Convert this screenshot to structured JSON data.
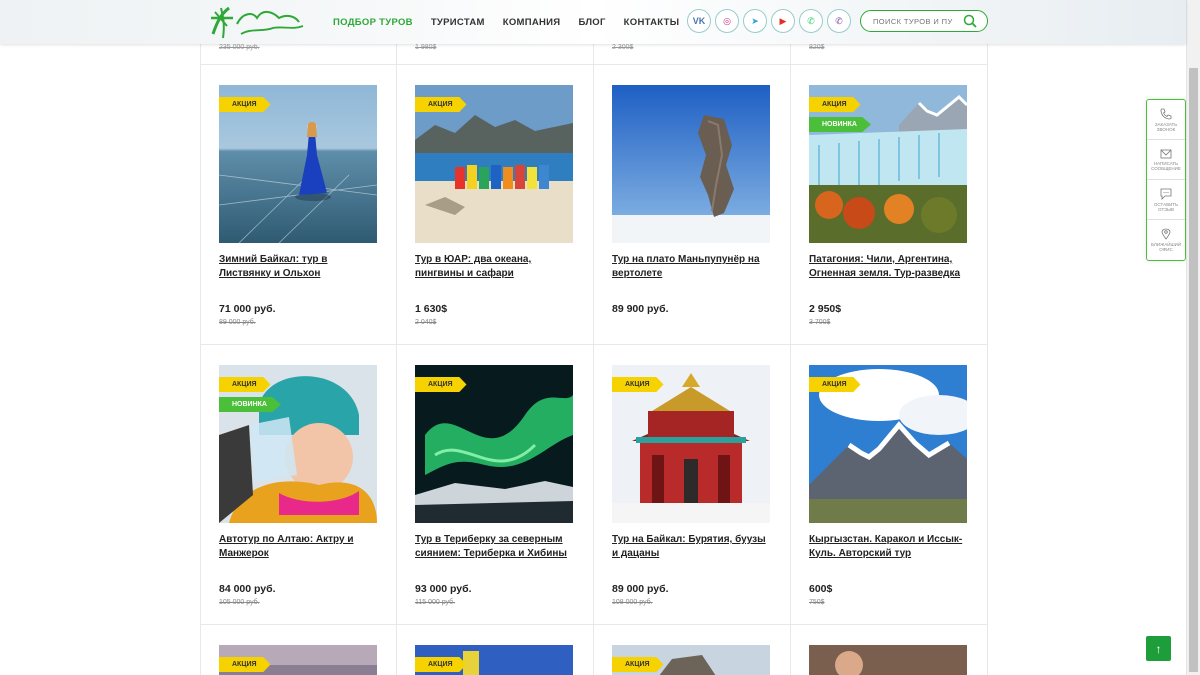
{
  "header": {
    "nav": [
      "ПОДБОР ТУРОВ",
      "ТУРИСТАМ",
      "КОМПАНИЯ",
      "БЛОГ",
      "КОНТАКТЫ"
    ],
    "socials": [
      {
        "name": "vk",
        "label": "VK",
        "color": "#4a76a8"
      },
      {
        "name": "instagram",
        "label": "◎",
        "color": "#c13584"
      },
      {
        "name": "telegram",
        "label": "➤",
        "color": "#2aa3df"
      },
      {
        "name": "youtube",
        "label": "▶",
        "color": "#e52d27"
      },
      {
        "name": "whatsapp",
        "label": "✆",
        "color": "#25d366"
      },
      {
        "name": "viber",
        "label": "✆",
        "color": "#7b519d"
      }
    ],
    "search_placeholder": "ПОИСК ТУРОВ И ПУ"
  },
  "top_row_old_prices": [
    "235 000 руб.",
    "1 980$",
    "2 300$",
    "820$"
  ],
  "rows": [
    [
      {
        "title": "Зимний Байкал: тур в Листвянку и Ольхон",
        "price": "71 000 руб.",
        "old": "89 000 руб.",
        "badges": [
          "АКЦИЯ"
        ]
      },
      {
        "title": "Тур в ЮАР: два океана, пингвины и сафари",
        "price": "1 630$",
        "old": "2 040$",
        "badges": [
          "АКЦИЯ"
        ]
      },
      {
        "title": "Тур на плато Маньпупунёр на вертолете",
        "price": "89 900 руб.",
        "old": "",
        "badges": []
      },
      {
        "title": "Патагония: Чили, Аргентина, Огненная земля. Тур-разведка",
        "price": "2 950$",
        "old": "3 700$",
        "badges": [
          "АКЦИЯ",
          "НОВИНКА"
        ]
      }
    ],
    [
      {
        "title": "Автотур по Алтаю: Актру и Манжерок",
        "price": "84 000 руб.",
        "old": "105 000 руб.",
        "badges": [
          "АКЦИЯ",
          "НОВИНКА"
        ]
      },
      {
        "title": "Тур в Териберку за северным сиянием: Териберка и Хибины",
        "price": "93 000 руб.",
        "old": "115 000 руб.",
        "badges": [
          "АКЦИЯ"
        ]
      },
      {
        "title": "Тур на Байкал: Бурятия, буузы и дацаны",
        "price": "89 000 руб.",
        "old": "108 000 руб.",
        "badges": [
          "АКЦИЯ"
        ]
      },
      {
        "title": "Кыргызстан. Каракол и Иссык-Куль. Авторский тур",
        "price": "600$",
        "old": "750$",
        "badges": [
          "АКЦИЯ"
        ]
      }
    ]
  ],
  "partial_badges": [
    "АКЦИЯ",
    "АКЦИЯ",
    "АКЦИЯ",
    ""
  ],
  "side": [
    {
      "name": "call",
      "label": "ЗАКАЗАТЬ ЗВОНОК"
    },
    {
      "name": "message",
      "label": "НАПИСАТЬ СООБЩЕНИЕ"
    },
    {
      "name": "review",
      "label": "ОСТАВИТЬ ОТЗЫВ"
    },
    {
      "name": "office",
      "label": "БЛИЖАЙШИЙ ОФИС"
    }
  ],
  "to_top": "↑"
}
